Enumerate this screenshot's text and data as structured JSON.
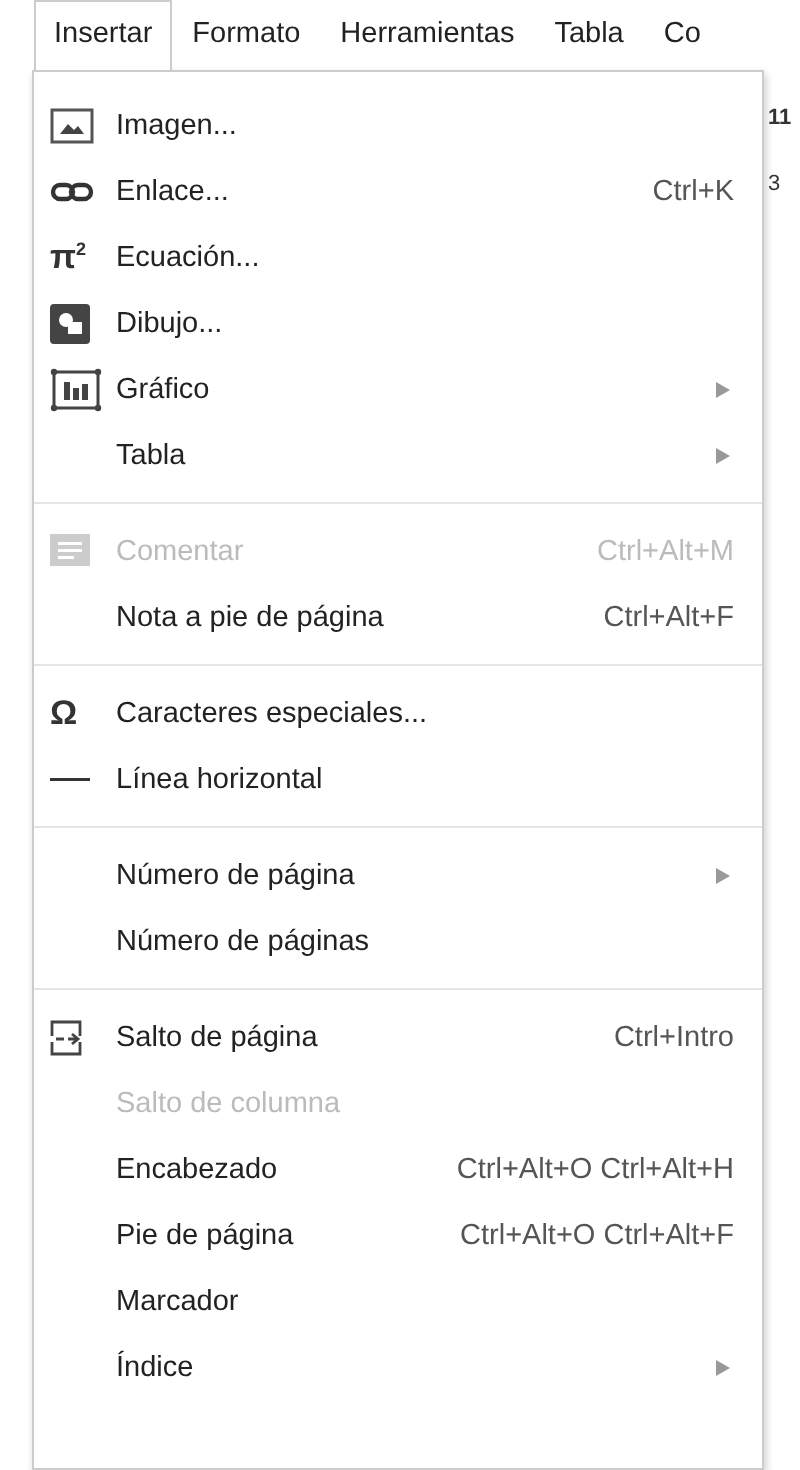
{
  "menubar": {
    "tabs": [
      {
        "label": "Insertar",
        "selected": true
      },
      {
        "label": "Formato",
        "selected": false
      },
      {
        "label": "Herramientas",
        "selected": false
      },
      {
        "label": "Tabla",
        "selected": false
      },
      {
        "label": "Co",
        "selected": false
      }
    ]
  },
  "background_fragments": [
    "11",
    "3"
  ],
  "menu": {
    "items": [
      {
        "kind": "image",
        "label": "Imagen...",
        "disabled": false,
        "submenu": false
      },
      {
        "kind": "link",
        "label": "Enlace...",
        "shortcut": "Ctrl+K",
        "disabled": false,
        "submenu": false
      },
      {
        "kind": "glyph",
        "glyph": "π$^{2}$",
        "label": "Ecuación...",
        "disabled": false,
        "submenu": false
      },
      {
        "kind": "drawing",
        "label": "Dibujo...",
        "disabled": false,
        "submenu": false
      },
      {
        "kind": "chart",
        "label": "Gráfico",
        "disabled": false,
        "submenu": true
      },
      {
        "kind": "plain",
        "label": "Tabla",
        "disabled": false,
        "submenu": true
      },
      {
        "kind": "separator"
      },
      {
        "kind": "comment",
        "label": "Comentar",
        "shortcut": "Ctrl+Alt+M",
        "disabled": true,
        "submenu": false
      },
      {
        "kind": "plain",
        "label": "Nota a pie de página",
        "shortcut": "Ctrl+Alt+F",
        "disabled": false,
        "submenu": false
      },
      {
        "kind": "separator"
      },
      {
        "kind": "glyph",
        "glyph": "Ω",
        "label": "Caracteres especiales...",
        "disabled": false,
        "submenu": false
      },
      {
        "kind": "line",
        "label": "Línea horizontal",
        "disabled": false,
        "submenu": false
      },
      {
        "kind": "separator"
      },
      {
        "kind": "plain",
        "label": "Número de página",
        "disabled": false,
        "submenu": true
      },
      {
        "kind": "plain",
        "label": "Número de páginas",
        "disabled": false,
        "submenu": false
      },
      {
        "kind": "separator"
      },
      {
        "kind": "pagebreak",
        "label": "Salto de página",
        "shortcut": "Ctrl+Intro",
        "disabled": false,
        "submenu": false
      },
      {
        "kind": "plain",
        "label": "Salto de columna",
        "disabled": true,
        "submenu": false
      },
      {
        "kind": "plain",
        "label": "Encabezado",
        "shortcut": "Ctrl+Alt+O Ctrl+Alt+H",
        "disabled": false,
        "submenu": false
      },
      {
        "kind": "plain",
        "label": "Pie de página",
        "shortcut": "Ctrl+Alt+O Ctrl+Alt+F",
        "disabled": false,
        "submenu": false
      },
      {
        "kind": "plain",
        "label": "Marcador",
        "disabled": false,
        "submenu": false
      },
      {
        "kind": "plain",
        "label": "Índice",
        "disabled": false,
        "submenu": true
      }
    ]
  }
}
